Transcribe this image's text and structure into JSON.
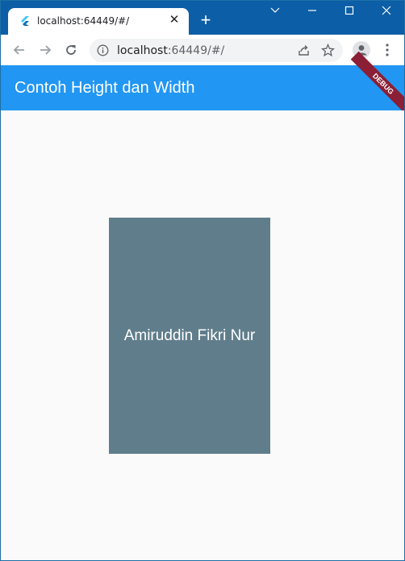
{
  "browser": {
    "tab": {
      "title": "localhost:64449/#/",
      "close_icon": "close-icon",
      "favicon": "flutter-logo-icon"
    },
    "new_tab_icon": "plus-icon",
    "window_controls": [
      "chevron-down-icon",
      "minimize-icon",
      "maximize-icon",
      "close-icon"
    ],
    "address_host": "localhost",
    "address_rest": ":64449/#/"
  },
  "app": {
    "title": "Contoh Height dan Width",
    "debug_banner": "DEBUG",
    "colors": {
      "appbar": "#2196f3",
      "box": "#607d8b",
      "background": "#fafafa"
    }
  },
  "box": {
    "text": "Amiruddin Fikri Nur"
  }
}
